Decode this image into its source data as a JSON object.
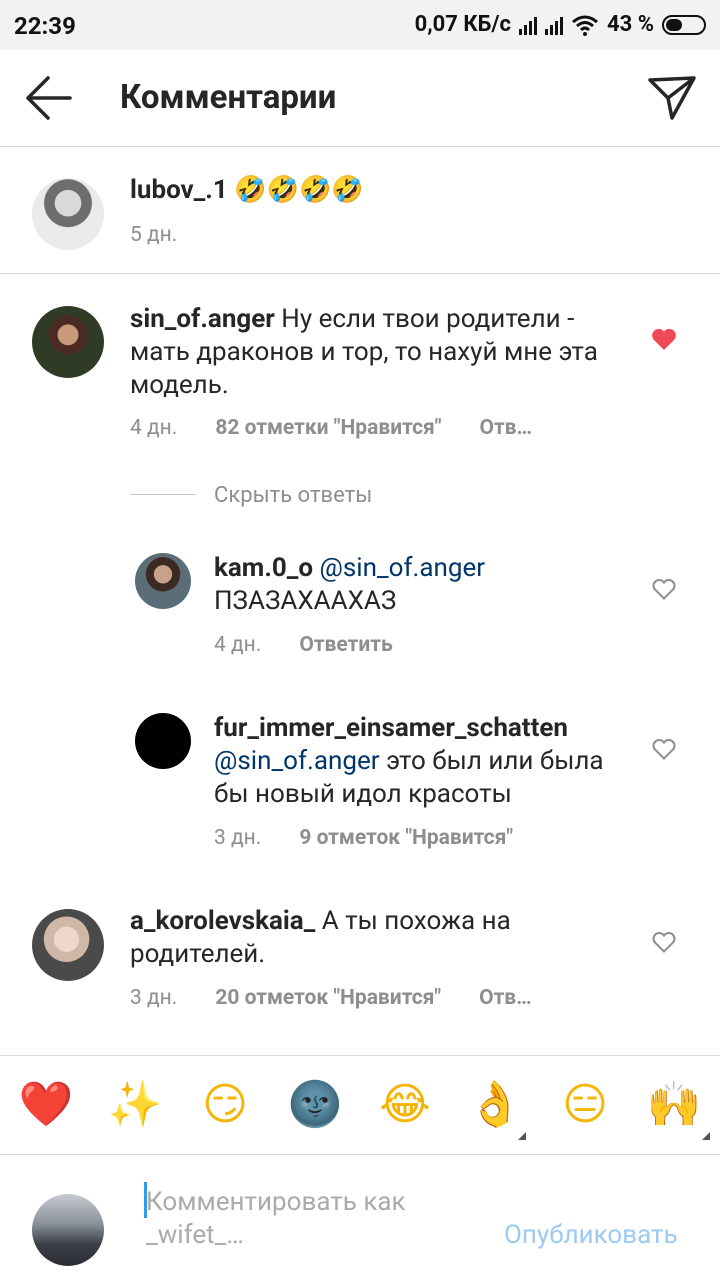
{
  "status_bar": {
    "time": "22:39",
    "net_speed": "0,07 КБ/с",
    "battery": "43 %",
    "icons": [
      "signal-icon",
      "signal-icon",
      "wifi-icon",
      "battery-icon"
    ]
  },
  "header": {
    "title": "Комментарии",
    "back_icon": "arrow-left-icon",
    "send_icon": "paper-plane-icon"
  },
  "caption": {
    "username": "lubov_.1",
    "text": "🤣🤣🤣🤣",
    "time": "5 дн."
  },
  "comments": [
    {
      "username": "sin_of.anger",
      "text": "Ну если твои родители - мать драконов и тор, то нахуй мне эта модель.",
      "time": "4 дн.",
      "likes": "82 отметки \"Нравится\"",
      "reply": "Отв…",
      "liked": true,
      "hide_replies": "Скрыть ответы",
      "replies": [
        {
          "username": "kam.0_o",
          "mention": "@sin_of.anger",
          "text": "ПЗАЗАХААХАЗ",
          "time": "4 дн.",
          "reply": "Ответить"
        },
        {
          "username": "fur_immer_einsamer_schatten",
          "mention": "@sin_of.anger",
          "text": "это был или была бы новый идол красоты",
          "time": "3 дн.",
          "likes": "9 отметок \"Нравится\""
        }
      ]
    },
    {
      "username": "a_korolevskaia_",
      "text": "А ты похожа на родителей.",
      "time": "3 дн.",
      "likes": "20 отметок \"Нравится\"",
      "reply": "Отв…",
      "liked": false
    }
  ],
  "emoji_bar": [
    "❤️",
    "✨",
    "😏",
    "🌚",
    "😂",
    "👌",
    "😑",
    "🙌"
  ],
  "composer": {
    "placeholder": "Комментировать как _wifet_…",
    "publish": "Опубликовать"
  },
  "colors": {
    "like_red": "#ed4956",
    "mention_blue": "#003569",
    "publish_blue": "#9ccaf3",
    "meta_gray": "#8e8e8e"
  }
}
